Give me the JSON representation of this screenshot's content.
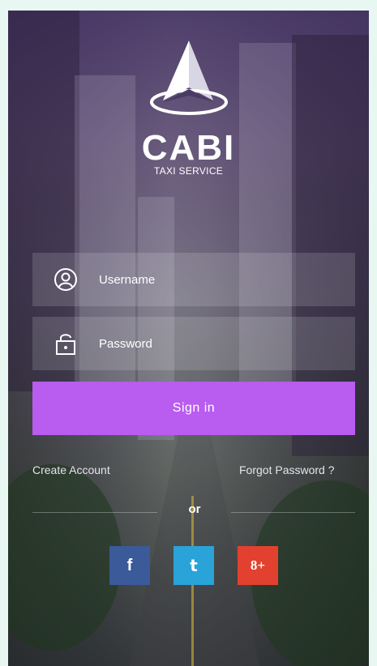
{
  "app": {
    "brand": "CABI",
    "tagline": "TAXI SERVICE"
  },
  "form": {
    "username_placeholder": "Username",
    "password_placeholder": "Password",
    "signin_label": "Sign in"
  },
  "links": {
    "create_account": "Create Account",
    "forgot_password": "Forgot Password ?"
  },
  "divider": {
    "label": "or"
  },
  "social": [
    {
      "name": "facebook",
      "glyph": "f",
      "color": "#3b5a9a"
    },
    {
      "name": "twitter",
      "glyph": "t",
      "color": "#2aa3d8"
    },
    {
      "name": "google-plus",
      "glyph": "8+",
      "color": "#e3412f"
    }
  ],
  "icons": {
    "logo": "cabi-logo-icon",
    "user": "user-circle-icon",
    "lock": "lock-icon"
  },
  "colors": {
    "accent": "#b95cf0",
    "overlay": "#4a3b66"
  }
}
